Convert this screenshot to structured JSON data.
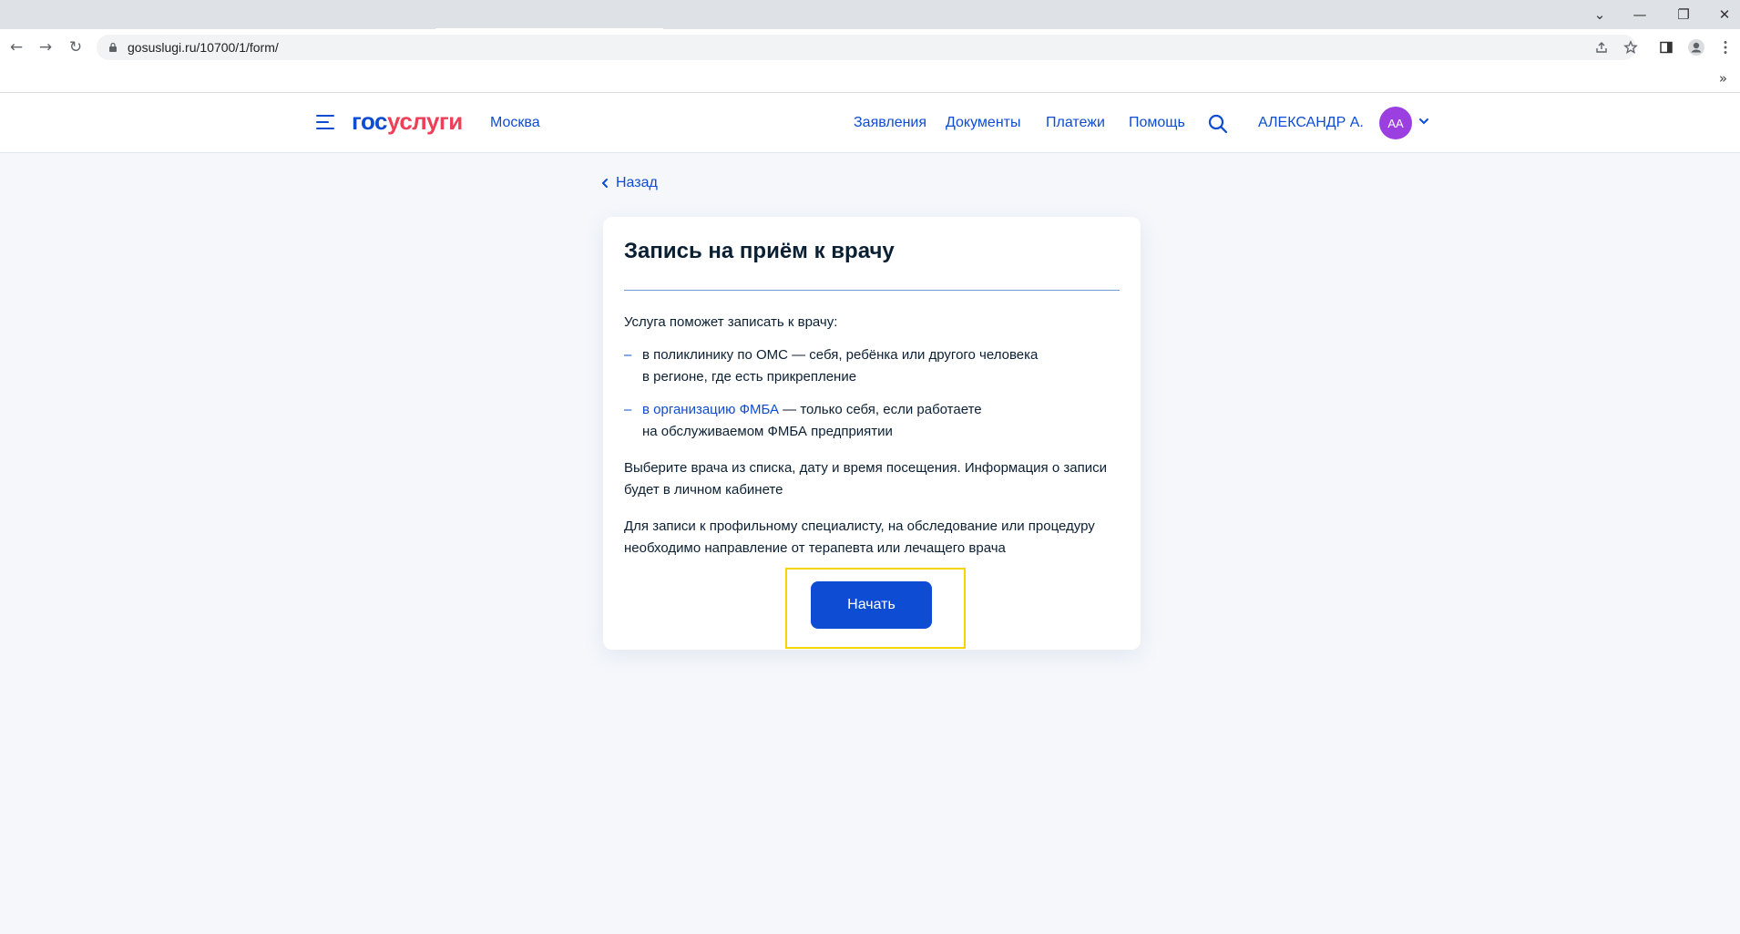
{
  "browser": {
    "url": "gosuslugi.ru/10700/1/form/",
    "window_controls": {
      "tabs": "⌄",
      "minimize": "—",
      "restore": "❐",
      "close": "✕"
    },
    "nav": {
      "back": "←",
      "forward": "→",
      "reload": "↻"
    },
    "bookmarks_more": "»"
  },
  "header": {
    "logo_part1": "гос",
    "logo_part2": "услуги",
    "city": "Москва",
    "nav": [
      "Заявления",
      "Документы",
      "Платежи",
      "Помощь"
    ],
    "user_name": "АЛЕКСАНДР А.",
    "avatar_initials": "АА"
  },
  "back_label": "Назад",
  "card": {
    "title": "Запись на приём к врачу",
    "intro": "Услуга поможет записать к врачу:",
    "item1_line1": "в поликлинику по ОМС — себя, ребёнка или другого человека",
    "item1_line2": "в регионе, где есть прикрепление",
    "item2_link": "в организацию ФМБА",
    "item2_rest": " — только себя, если работаете",
    "item2_line2": "на обслуживаемом ФМБА предприятии",
    "para2": "Выберите врача из списка, дату и время посещения. Информация о записи будет в личном кабинете",
    "para3": "Для записи к профильному специалисту, на обследование или процедуру необходимо направление от терапевта или лечащего врача",
    "dash": "–",
    "start_button": "Начать"
  },
  "colors": {
    "primary": "#0d4cd3",
    "logo_red": "#ee3f58",
    "avatar": "#9c3fe0",
    "highlight": "#f2d600"
  }
}
